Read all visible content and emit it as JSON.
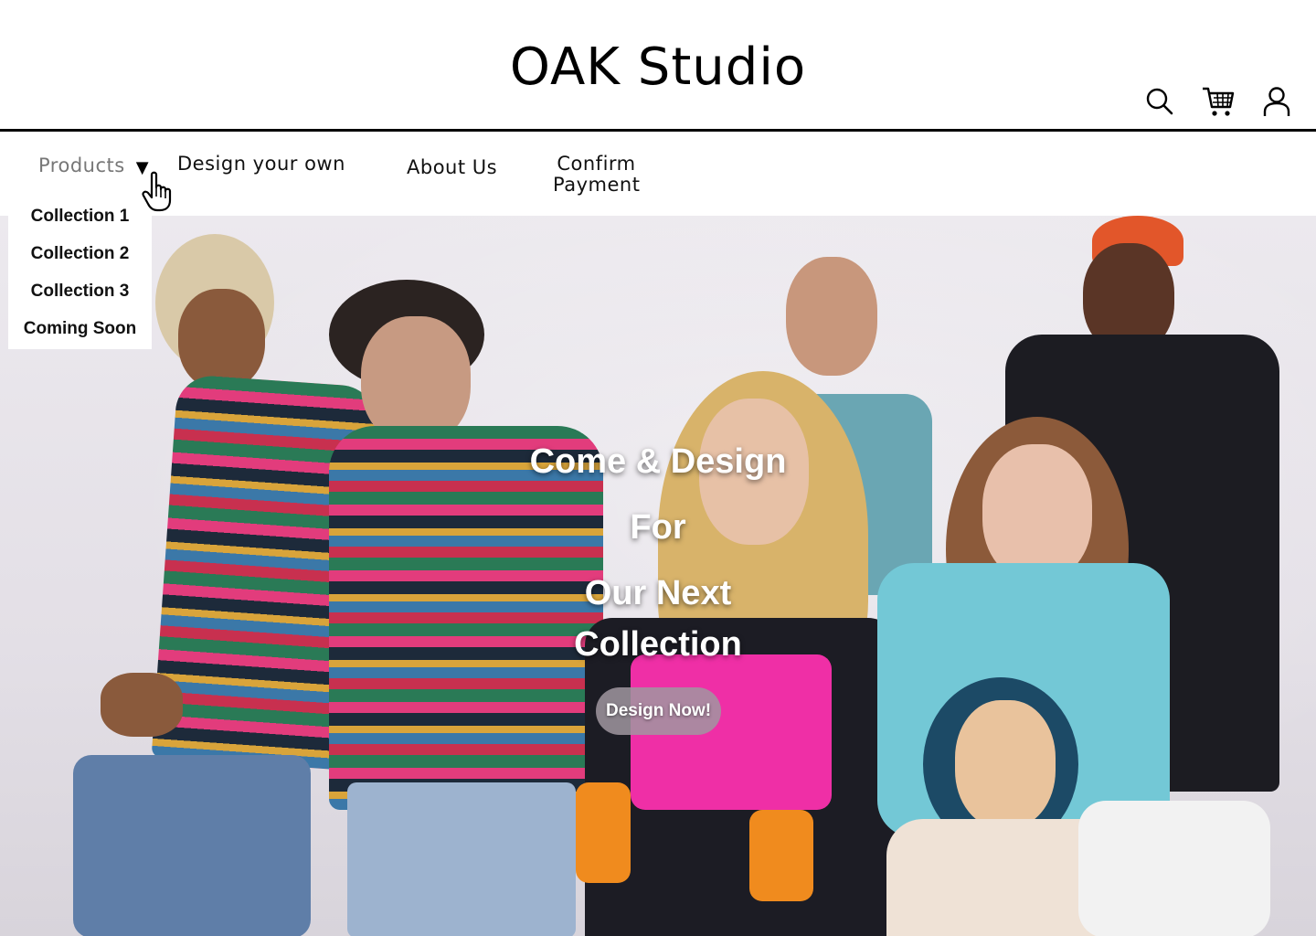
{
  "brand": {
    "title": "OAK Studio"
  },
  "header_icons": [
    "search-icon",
    "cart-icon",
    "user-icon"
  ],
  "nav": {
    "products": "Products",
    "design_your_own": "Design your own",
    "about_us": "About Us",
    "confirm_line1": "Confirm",
    "confirm_line2": "Payment"
  },
  "dropdown": {
    "items": [
      "Collection 1",
      "Collection 2",
      "Collection 3",
      "Coming Soon"
    ]
  },
  "hero": {
    "line1": "Come & Design",
    "line2": "For",
    "line3": "Our Next",
    "line4": "Collection",
    "cta": "Design Now!"
  },
  "colors": {
    "text": "#111111",
    "muted_nav": "#777777",
    "hero_background": "#e6e2e8",
    "cta_background": "#a096a0"
  }
}
